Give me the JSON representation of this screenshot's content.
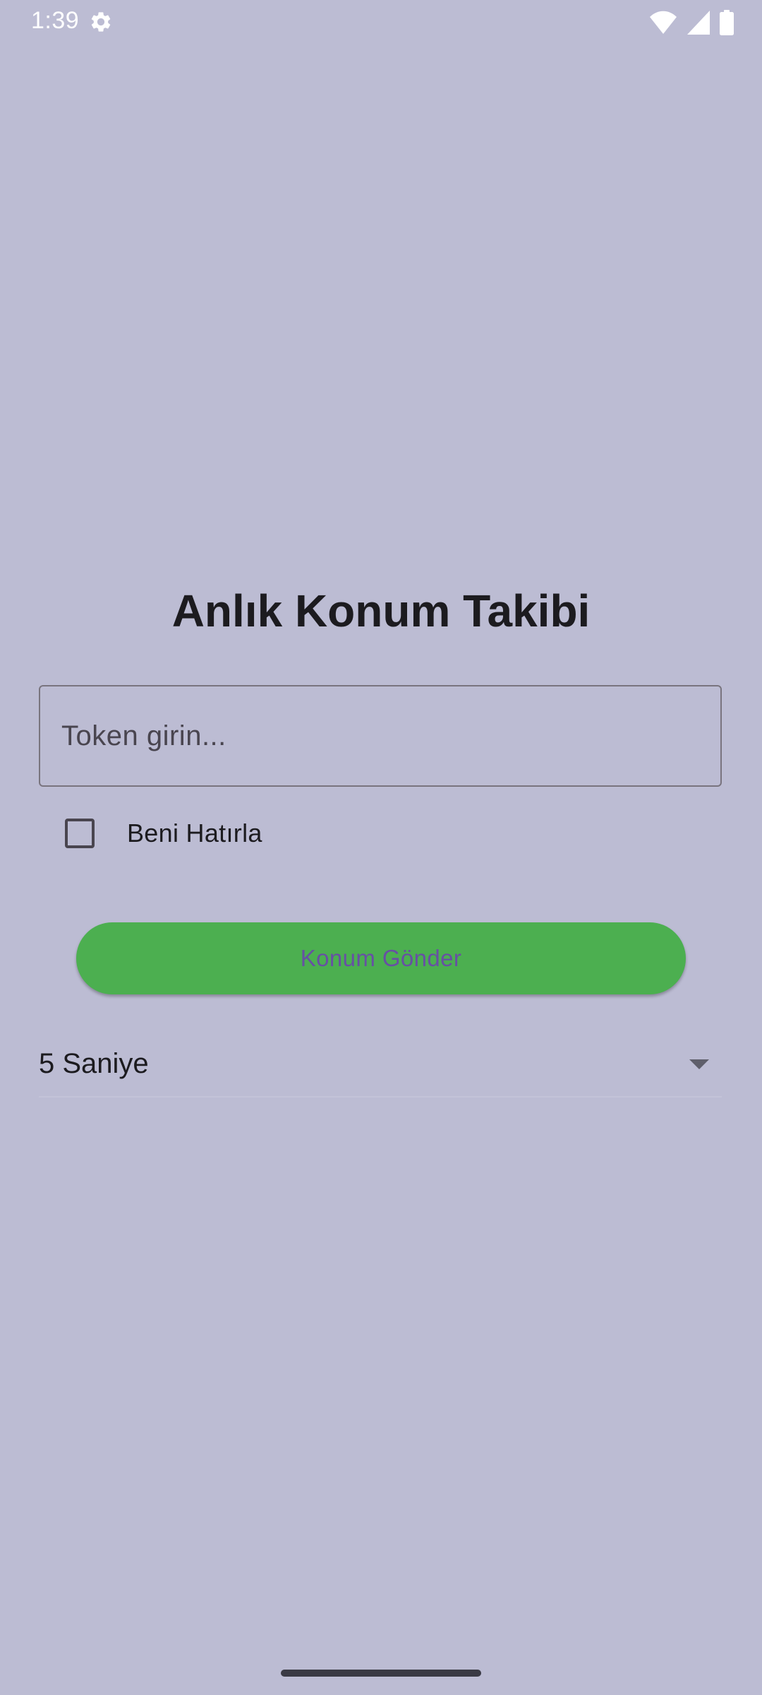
{
  "status_bar": {
    "time": "1:39",
    "icons": [
      "gear-icon",
      "wifi-icon",
      "signal-icon",
      "battery-icon"
    ]
  },
  "main": {
    "title": "Anlık Konum Takibi",
    "token_input": {
      "value": "",
      "placeholder": "Token girin..."
    },
    "remember_me": {
      "label": "Beni Hatırla",
      "checked": false
    },
    "send_button": {
      "label": "Konum Gönder"
    },
    "interval_dropdown": {
      "selected": "5 Saniye"
    }
  },
  "colors": {
    "background": "#bcbcd3",
    "button": "#4caf50",
    "button_text": "#6750a4",
    "text": "#1c1b1f",
    "status_text": "#ffffff"
  }
}
